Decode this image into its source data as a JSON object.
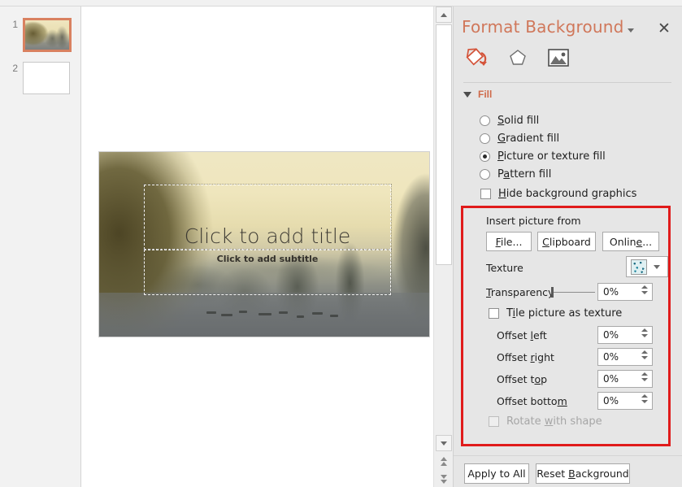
{
  "thumbnails": {
    "slides": [
      {
        "number": "1",
        "selected": true,
        "kind": "halong-photo"
      },
      {
        "number": "2",
        "selected": false,
        "kind": "blank"
      }
    ]
  },
  "slide": {
    "title_placeholder": "Click to add title",
    "subtitle_placeholder": "Click to add subtitle"
  },
  "scrollbar": {
    "up_icon": "triangle-up-icon",
    "down_icon": "triangle-down-icon",
    "prev_slide_icon": "double-up-icon",
    "next_slide_icon": "double-down-icon"
  },
  "pane": {
    "title": "Format Background",
    "caret_icon": "chevron-down-icon",
    "close_icon": "close-icon",
    "tabs": [
      {
        "name": "fill-icon",
        "label": "Fill",
        "selected": true
      },
      {
        "name": "effects-icon",
        "label": "Effects",
        "selected": false
      },
      {
        "name": "picture-icon",
        "label": "Picture",
        "selected": false
      }
    ],
    "fill_section": {
      "header": "Fill",
      "expander_icon": "triangle-expanded-icon",
      "options": [
        {
          "label": "Solid fill",
          "accel": "S",
          "selected": false
        },
        {
          "label": "Gradient fill",
          "accel": "G",
          "selected": false
        },
        {
          "label": "Picture or texture fill",
          "accel": "P",
          "selected": true
        },
        {
          "label": "Pattern fill",
          "accel": "a",
          "selected": false
        }
      ],
      "hide_background_graphics": {
        "label": "Hide background graphics",
        "accel": "H",
        "checked": false
      }
    },
    "insert_picture": {
      "label": "Insert picture from",
      "buttons": [
        {
          "label": "File...",
          "accel": "F"
        },
        {
          "label": "Clipboard",
          "accel": "C"
        },
        {
          "label": "Online...",
          "accel": "e"
        }
      ]
    },
    "texture": {
      "label": "Texture",
      "swatch_icon": "texture-swatch-icon",
      "caret_icon": "chevron-down-icon"
    },
    "transparency": {
      "label": "Transparency",
      "accel": "T",
      "value": "0%",
      "slider_position_percent": 0
    },
    "tile_picture": {
      "label": "Tile picture as texture",
      "accel": "i",
      "checked": false
    },
    "offsets": [
      {
        "label": "Offset left",
        "accel": "l",
        "value": "0%"
      },
      {
        "label": "Offset right",
        "accel": "r",
        "value": "0%"
      },
      {
        "label": "Offset top",
        "accel": "o",
        "value": "0%"
      },
      {
        "label": "Offset bottom",
        "accel": "m",
        "value": "0%"
      }
    ],
    "rotate_with_shape": {
      "label": "Rotate with shape",
      "accel": "w",
      "checked": false,
      "disabled": true
    },
    "footer_buttons": [
      {
        "label": "Apply to All",
        "accel": ""
      },
      {
        "label": "Reset Background",
        "accel": "B"
      }
    ],
    "highlight_box_color": "#e01b1b"
  }
}
